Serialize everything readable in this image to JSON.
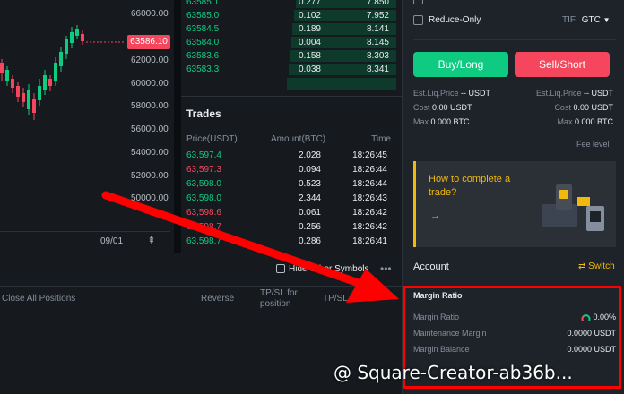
{
  "chart": {
    "price_ticks": [
      "66000.00",
      "62000.00",
      "60000.00",
      "58000.00",
      "56000.00",
      "54000.00",
      "52000.00",
      "50000.00"
    ],
    "current_price_tag": "63586.10",
    "date_label": "09/01",
    "axis_toggle_icon": "⇞"
  },
  "orderbook": {
    "rows": [
      {
        "price": "63585.1",
        "amount": "0.277",
        "total": "7.850"
      },
      {
        "price": "63585.0",
        "amount": "0.102",
        "total": "7.952"
      },
      {
        "price": "63584.5",
        "amount": "0.189",
        "total": "8.141"
      },
      {
        "price": "63584.0",
        "amount": "0.004",
        "total": "8.145"
      },
      {
        "price": "63583.6",
        "amount": "0.158",
        "total": "8.303"
      },
      {
        "price": "63583.3",
        "amount": "0.038",
        "total": "8.341"
      }
    ]
  },
  "trades": {
    "title": "Trades",
    "headers": {
      "price": "Price(USDT)",
      "amount": "Amount(BTC)",
      "time": "Time"
    },
    "rows": [
      {
        "price": "63,597.4",
        "amount": "2.028",
        "time": "18:26:45",
        "side": "buy"
      },
      {
        "price": "63,597.3",
        "amount": "0.094",
        "time": "18:26:44",
        "side": "sell"
      },
      {
        "price": "63,598.0",
        "amount": "0.523",
        "time": "18:26:44",
        "side": "buy"
      },
      {
        "price": "63,598.0",
        "amount": "2.344",
        "time": "18:26:43",
        "side": "buy"
      },
      {
        "price": "63,598.6",
        "amount": "0.061",
        "time": "18:26:42",
        "side": "sell"
      },
      {
        "price": "63,598.7",
        "amount": "0.256",
        "time": "18:26:42",
        "side": "sell"
      },
      {
        "price": "63,598.7",
        "amount": "0.286",
        "time": "18:26:41",
        "side": "buy"
      }
    ]
  },
  "positions": {
    "hide_other_symbols": "Hide Other Symbols",
    "more_icon": "•••",
    "columns": [
      "Close All Positions",
      "Reverse",
      "TP/SL for position",
      "TP/SL"
    ]
  },
  "order_form": {
    "reduce_only": "Reduce-Only",
    "tif_label": "TIF",
    "tif_value": "GTC",
    "buy_label": "Buy/Long",
    "sell_label": "Sell/Short",
    "buy_info": {
      "liq_label": "Est.Liq.Price",
      "liq_value": "-- USDT",
      "cost_label": "Cost",
      "cost_value": "0.00 USDT",
      "max_label": "Max",
      "max_value": "0.000 BTC"
    },
    "sell_info": {
      "liq_label": "Est.Liq.Price",
      "liq_value": "-- USDT",
      "cost_label": "Cost",
      "cost_value": "0.00 USDT",
      "max_label": "Max",
      "max_value": "0.000 BTC"
    },
    "fee_level": "Fee level"
  },
  "promo": {
    "text": "How to complete a trade?",
    "arrow": "→"
  },
  "account": {
    "title": "Account",
    "switch_label": "Switch",
    "switch_icon": "⇄",
    "margin_title": "Margin Ratio",
    "rows": [
      {
        "label": "Margin Ratio",
        "value": "0.00%"
      },
      {
        "label": "Maintenance Margin",
        "value": "0.0000 USDT"
      },
      {
        "label": "Margin Balance",
        "value": "0.0000 USDT"
      }
    ]
  },
  "watermark": "@ Square-Creator-ab36b...",
  "colors": {
    "buy": "#0ecb81",
    "sell": "#f6465d",
    "accent": "#f0b90b",
    "annotation": "#ff0000"
  }
}
